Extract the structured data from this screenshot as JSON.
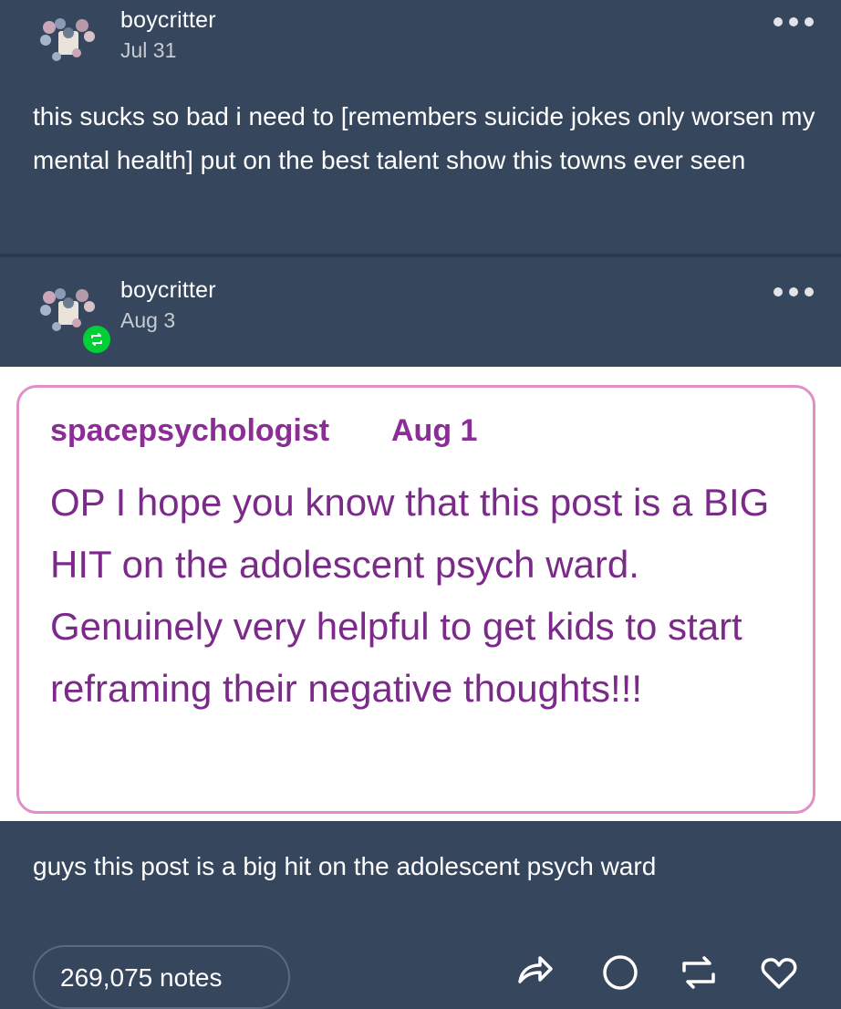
{
  "post": {
    "username": "boycritter",
    "date": "Jul 31",
    "text": "this sucks so bad i need to [remembers suicide jokes only worsen my mental health] put on the best talent show this towns ever seen"
  },
  "reblog": {
    "username": "boycritter",
    "date": "Aug 3",
    "badge_icon": "reblog-icon",
    "badge_color": "#00cf35",
    "screenshot": {
      "author": "spacepsychologist",
      "date": "Aug 1",
      "text": "OP I hope you know that this post is a BIG HIT on the adolescent psych ward. Genuinely very helpful to get kids to start reframing their negative thoughts!!!",
      "text_color": "#7b2a8a",
      "border_color": "#e08fc7"
    },
    "comment": "guys this post is a big hit on the adolescent psych ward"
  },
  "footer": {
    "notes": "269,075 notes",
    "actions": [
      "share-icon",
      "reply-icon",
      "reblog-icon",
      "like-icon"
    ]
  },
  "colors": {
    "background": "#36465d",
    "text": "#ffffff"
  }
}
